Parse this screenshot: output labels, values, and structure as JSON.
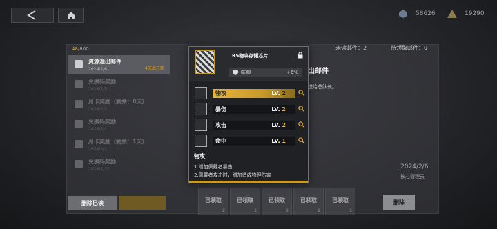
{
  "topbar": {
    "back_icon": "back-arrow-icon",
    "home_icon": "home-icon",
    "currency1": "58626",
    "currency2": "19290"
  },
  "mailbox": {
    "count": "48",
    "capacity": "/800",
    "unread_label": "未读邮件：2",
    "pending_label": "待领取邮件：0",
    "items": [
      {
        "title": "资源溢出邮件",
        "date": "2024/2/6",
        "expire": "4天后过期"
      },
      {
        "title": "兑换码奖励",
        "date": "2024/2/5",
        "expire": ""
      },
      {
        "title": "月卡奖励（剩余：0天）",
        "date": "2024/2/5",
        "expire": ""
      },
      {
        "title": "兑换码奖励",
        "date": "2024/2/1",
        "expire": ""
      },
      {
        "title": "月卡奖励（剩余：1天）",
        "date": "2024/2/1",
        "expire": ""
      },
      {
        "title": "兑换码奖励",
        "date": "2024/1/31",
        "expire": ""
      }
    ],
    "delete_read_label": "删除已读",
    "detail_title": "出邮件",
    "detail_body": "送给总队长。",
    "detail_date": "2024/2/6",
    "detail_sender": "核心管理员",
    "rewards": [
      {
        "label": "已领取",
        "count": "2"
      },
      {
        "label": "已领取",
        "count": "1"
      },
      {
        "label": "已领取",
        "count": "1"
      },
      {
        "label": "已领取",
        "count": "2"
      },
      {
        "label": "已领取",
        "count": "1"
      }
    ],
    "delete_label": "删除"
  },
  "popup": {
    "chip_name": "R5物攻存储芯片",
    "def_label": "防御",
    "def_value": "+6%",
    "stats": [
      {
        "name": "物攻",
        "lv_label": "LV.",
        "lv": "2",
        "selected": true
      },
      {
        "name": "暴伤",
        "lv_label": "LV.",
        "lv": "2",
        "selected": false
      },
      {
        "name": "攻击",
        "lv_label": "LV.",
        "lv": "2",
        "selected": false
      },
      {
        "name": "命中",
        "lv_label": "LV.",
        "lv": "1",
        "selected": false
      }
    ],
    "desc_title": "物攻",
    "desc_lines": [
      "1.增加佩戴者暴击",
      "2.佩戴者攻击时，增加造成物理伤害"
    ]
  },
  "colors": {
    "accent": "#c79a2b",
    "gold_text": "#e7b13a"
  }
}
